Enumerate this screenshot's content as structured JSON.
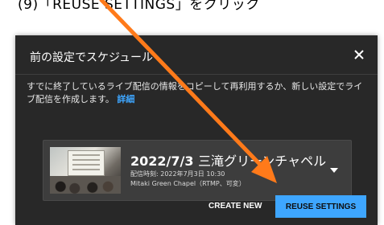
{
  "instruction": "(9)「REUSE SETTINGS」をクリック",
  "dialog": {
    "title": "前の設定でスケジュール",
    "description": "すでに終了しているライブ配信の情報をコピーして再利用するか、新しい設定でライブ配信を作成します。",
    "details_link": "詳細",
    "card": {
      "title_date": "2022/7/3",
      "title_name": "三滝グリーンチャペル",
      "time": "配信時刻: 2022年7月3日 10:30",
      "subtitle": "Mitaki Green Chapel（RTMP、可変）"
    },
    "create_new": "CREATE NEW",
    "reuse_settings": "REUSE SETTINGS"
  },
  "colors": {
    "accent": "#3ea6ff",
    "arrow": "#ff7a1a",
    "dialog_bg": "#282828"
  },
  "icons": [
    "close-icon",
    "chevron-down-icon",
    "arrow-annotation"
  ]
}
